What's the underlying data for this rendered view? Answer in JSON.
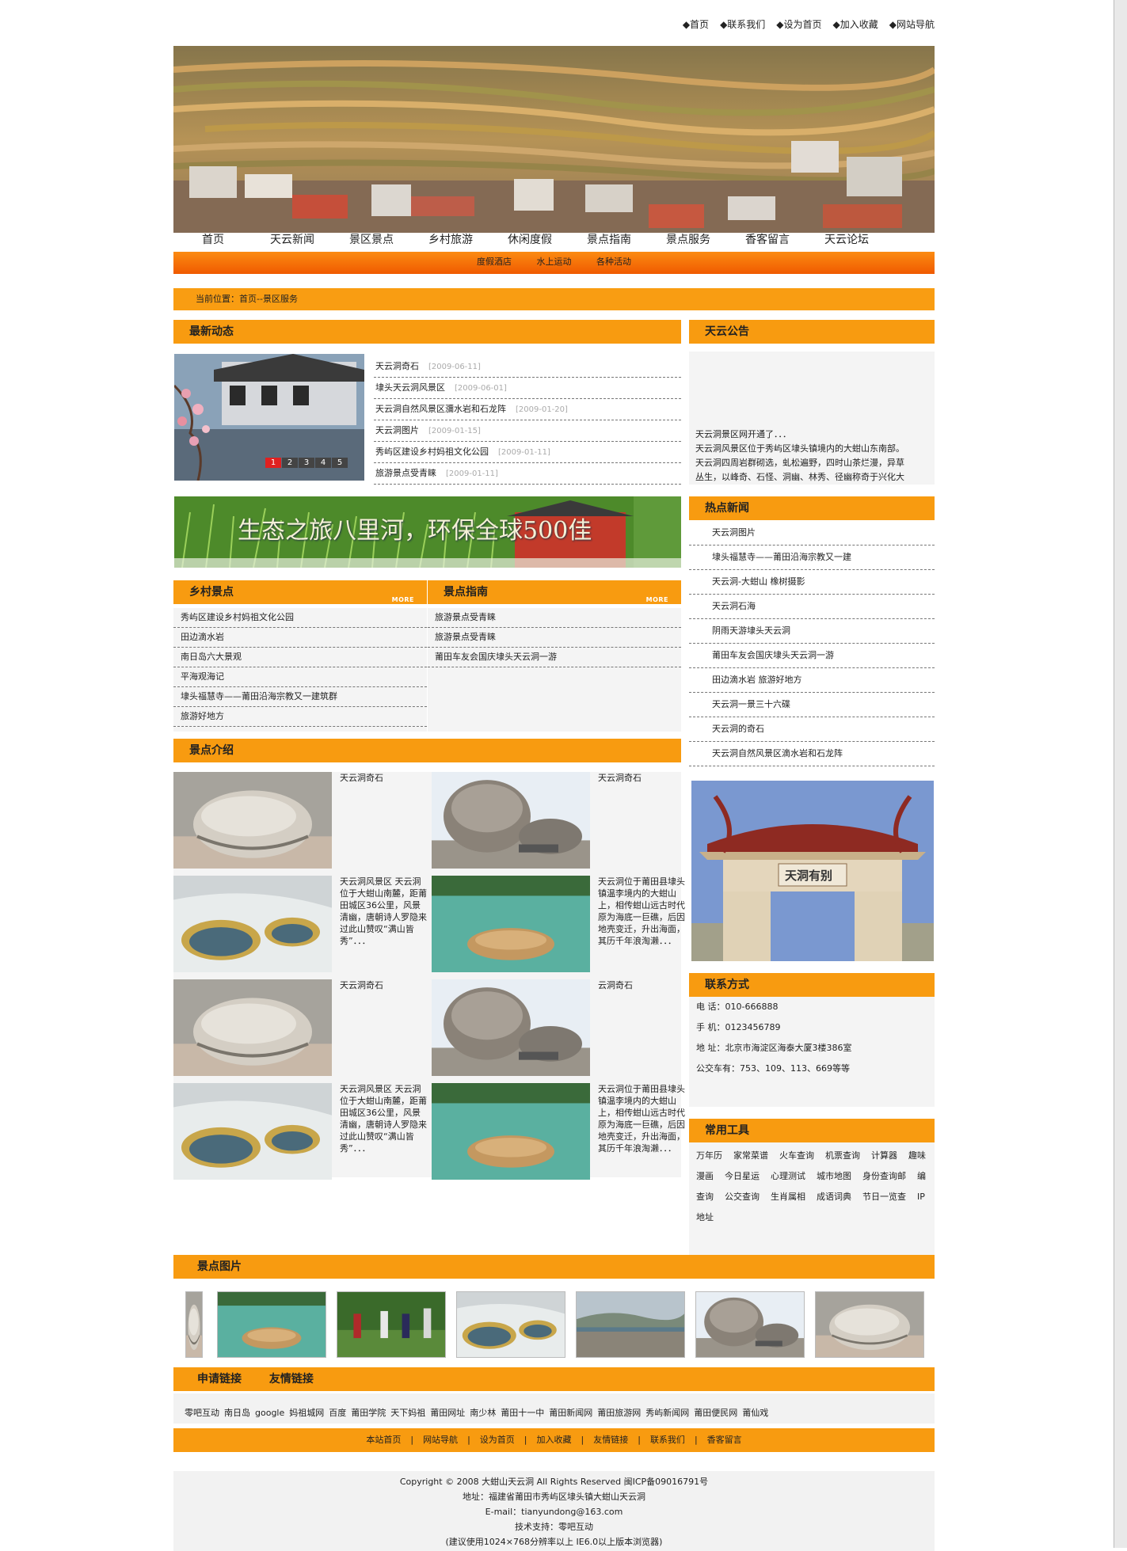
{
  "top_links": [
    "◆首页",
    "◆联系我们",
    "◆设为首页",
    "◆加入收藏",
    "◆网站导航"
  ],
  "main_nav": [
    "首页",
    "天云新闻",
    "景区景点",
    "乡村旅游",
    "休闲度假",
    "景点指南",
    "景点服务",
    "香客留言",
    "天云论坛"
  ],
  "sub_nav": [
    "度假酒店",
    "水上运动",
    "各种活动"
  ],
  "breadcrumb": "当前位置：首页--景区服务",
  "latest": {
    "title": "最新动态",
    "pages": [
      "1",
      "2",
      "3",
      "4",
      "5"
    ],
    "items": [
      {
        "title": "天云洞奇石",
        "date": "[2009-06-11]"
      },
      {
        "title": "埭头天云洞风景区",
        "date": "[2009-06-01]"
      },
      {
        "title": "天云洞自然风景区瀰水岩和石龙阵",
        "date": "[2009-01-20]"
      },
      {
        "title": "天云洞图片",
        "date": "[2009-01-15]"
      },
      {
        "title": "秀屿区建设乡村妈祖文化公园",
        "date": "[2009-01-11]"
      },
      {
        "title": "旅游景点受青睐",
        "date": "[2009-01-11]"
      }
    ]
  },
  "notice": {
    "title": "天云公告",
    "lines": [
      "天云洞景区网开通了．．．",
      "天云洞风景区位于秀屿区埭头镇境内的大蚶山东南部。",
      "天云洞四周岩群砌选，虬松遍野，四时山茶烂漫，异草",
      "丛生，以峰奇、石怪、洞幽、林秀、径幽称奇于兴化大"
    ]
  },
  "ad_banner": "生态之旅八里河，环保全球500佳",
  "rural": {
    "title": "乡村景点",
    "more": "MORE",
    "items": [
      "秀屿区建设乡村妈祖文化公园",
      "田边滴水岩",
      "南日岛六大景观",
      "平海观海记",
      "埭头福慧寺——莆田沿海宗教又一建筑群",
      "旅游好地方"
    ]
  },
  "guide": {
    "title": "景点指南",
    "more": "MORE",
    "items": [
      "旅游景点受青睐",
      "旅游景点受青睐",
      "莆田车友会国庆埭头天云洞一游"
    ]
  },
  "intro": {
    "title": "景点介绍",
    "items": [
      {
        "text": "天云洞奇石",
        "img": "rock-flat"
      },
      {
        "text": "天云洞奇石",
        "img": "rock-tall"
      },
      {
        "text": "天云洞风景区 天云洞位于大蚶山南麓，距莆田城区36公里，风景清幽，唐朝诗人罗隐来过此山赞叹“满山皆秀”．．．",
        "img": "pools"
      },
      {
        "text": "天云洞位于莆田县埭头镇温李境内的大蚶山上，相传蚶山远古时代原为海底一巨礁，后因地壳变迁，升出海面，其历千年浪淘濑．．．",
        "img": "lake"
      },
      {
        "text": "天云洞奇石",
        "img": "rock-flat"
      },
      {
        "text": "云洞奇石",
        "img": "rock-tall"
      },
      {
        "text": "天云洞风景区 天云洞位于大蚶山南麓，距莆田城区36公里，风景清幽，唐朝诗人罗隐来过此山赞叹“满山皆秀”．．．",
        "img": "pools"
      },
      {
        "text": "天云洞位于莆田县埭头镇温李境内的大蚶山上，相传蚶山远古时代原为海底一巨礁，后因地壳变迁，升出海面，其历千年浪淘濑．．．",
        "img": "lake"
      }
    ]
  },
  "hot_news": {
    "title": "热点新闻",
    "items": [
      "天云洞图片",
      "埭头福慧寺——莆田沿海宗教又一建",
      "天云洞-大蚶山 橡树摄影",
      "天云洞石海",
      "阴雨天游埭头天云洞",
      "莆田车友会国庆埭头天云洞一游",
      "田边滴水岩 旅游好地方",
      "天云洞一景三十六碟",
      "天云洞的奇石",
      "天云洞自然风景区滴水岩和石龙阵"
    ]
  },
  "gate_sign": "天洞有别",
  "contact": {
    "title": "联系方式",
    "lines": [
      "电 话：010-666888",
      "手 机：0123456789",
      "地 址：北京市海淀区海泰大厦3楼386室",
      "公交车有：753、109、113、669等等"
    ]
  },
  "tools": {
    "title": "常用工具",
    "items": [
      "万年历",
      "家常菜谱",
      "火车查询",
      "机票查询",
      "计算器",
      "趣味漫画",
      "今日星运",
      "心理测试",
      "城市地图",
      "身份查询邮",
      "编查询",
      "公交查询",
      "生肖属相",
      "成语词典",
      "节日一览查",
      "IP地址"
    ]
  },
  "gallery": {
    "title": "景点图片",
    "images": [
      "rock-flat",
      "lake",
      "people",
      "pools",
      "shore",
      "rock-tall",
      "rock-flat"
    ]
  },
  "links": {
    "tab1": "申请链接",
    "tab2": "友情链接",
    "items": [
      "零吧互动",
      "南日岛",
      "google",
      "妈祖城网",
      "百度",
      "莆田学院",
      "天下妈祖",
      "莆田网址",
      "南少林",
      "莆田十一中",
      "莆田新闻网",
      "莆田旅游网",
      "秀屿新闻网",
      "莆田便民网",
      "莆仙戏"
    ]
  },
  "bottom_nav": [
    "本站首页",
    "|",
    "网站导航",
    "|",
    "设为首页",
    "|",
    "加入收藏",
    "|",
    "友情链接",
    "|",
    "联系我们",
    "|",
    "香客留言"
  ],
  "footer": [
    "Copyright © 2008 大蚶山天云洞 All Rights Reserved 闽ICP备09016791号",
    "地址：福建省莆田市秀屿区埭头镇大蚶山天云洞",
    "E-mail：tianyundong@163.com",
    "技术支持：零吧互动",
    "(建议使用1024×768分辨率以上 IE6.0以上版本浏览器)"
  ],
  "colors": {
    "orange": "#f89b10",
    "orange_dark": "#f05a00",
    "panel": "#f4f4f4"
  }
}
